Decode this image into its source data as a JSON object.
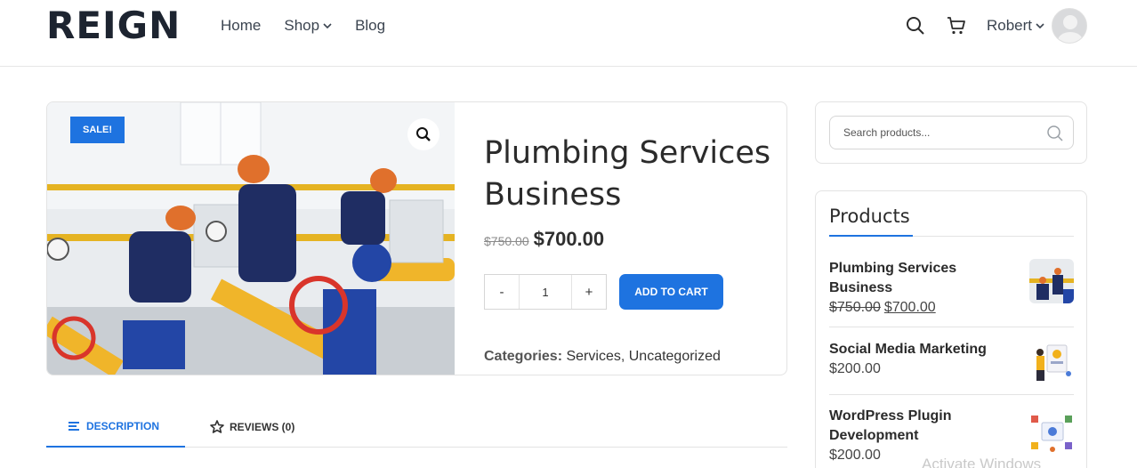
{
  "header": {
    "logo": "REIGN",
    "nav": [
      {
        "label": "Home"
      },
      {
        "label": "Shop"
      },
      {
        "label": "Blog"
      }
    ],
    "user": "Robert"
  },
  "product": {
    "sale_badge": "SALE!",
    "title": "Plumbing Services Business",
    "price_old": "$750.00",
    "price_new": "$700.00",
    "qty_minus": "-",
    "qty_value": "1",
    "qty_plus": "+",
    "add_to_cart": "ADD TO CART",
    "categories_label": "Categories:",
    "category_1": "Services",
    "category_sep": ", ",
    "category_2": "Uncategorized"
  },
  "tabs": {
    "description": "DESCRIPTION",
    "reviews": "REVIEWS (0)"
  },
  "sidebar": {
    "search_placeholder": "Search products...",
    "products_heading": "Products",
    "items": [
      {
        "name": "Plumbing Services Business",
        "price_old": "$750.00",
        "price_new": "$700.00"
      },
      {
        "name": "Social Media Marketing",
        "price": "$200.00"
      },
      {
        "name": "WordPress Plugin Development",
        "price": "$200.00"
      }
    ]
  },
  "watermark": "Activate Windows",
  "colors": {
    "accent": "#1e73e0",
    "text_dark": "#2b2b2b",
    "border": "#e3e3e3"
  }
}
